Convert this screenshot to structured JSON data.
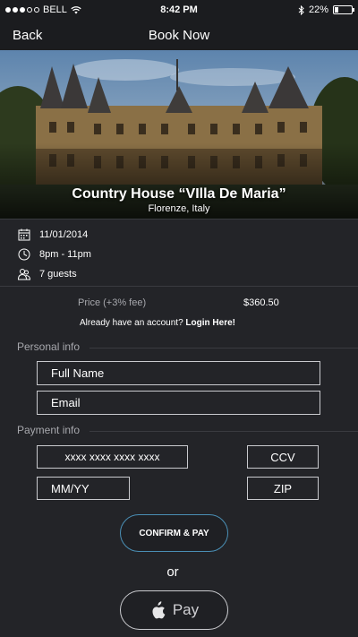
{
  "status_bar": {
    "carrier": "BELL",
    "time": "8:42 PM",
    "battery": "22%",
    "battery_level": 0.22,
    "signal_bars_filled": 3,
    "signal_bars_total": 5
  },
  "nav": {
    "back_label": "Back",
    "title": "Book Now"
  },
  "hero": {
    "title": "Country House “VIlla De Maria”",
    "subtitle": "Florenze, Italy"
  },
  "booking": {
    "date": "11/01/2014",
    "time": "8pm - 11pm",
    "guests": "7 guests"
  },
  "price": {
    "label": "Price (+3% fee)",
    "value": "$360.50"
  },
  "account": {
    "prompt": "Already have an account?",
    "login_link": "Login Here!"
  },
  "personal": {
    "section_label": "Personal info",
    "full_name": "Full Name",
    "email": "Email"
  },
  "payment": {
    "section_label": "Payment info",
    "card_number": "xxxx xxxx xxxx xxxx",
    "ccv": "CCV",
    "expiry": "MM/YY",
    "zip": "ZIP"
  },
  "actions": {
    "confirm_label": "CONFIRM & PAY",
    "or_label": "or",
    "apple_pay_label": "Pay"
  },
  "colors": {
    "background": "#232428",
    "confirm_border": "#4a8fb5",
    "field_border": "#c9cace",
    "muted_text": "#a7a8ad"
  }
}
